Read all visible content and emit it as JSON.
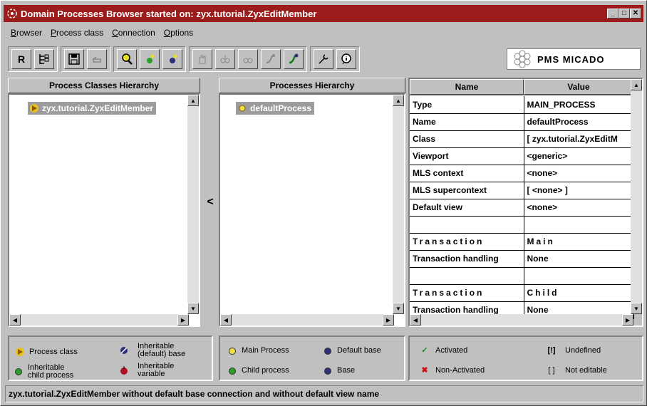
{
  "window": {
    "title": "Domain Processes Browser started on: zyx.tutorial.ZyxEditMember"
  },
  "menu": [
    "Browser",
    "Process class",
    "Connection",
    "Options"
  ],
  "toolbar": {
    "r_label": "R",
    "brand": "PMS MICADO"
  },
  "left_panel": {
    "header": "Process Classes Hierarchy",
    "item": "zyx.tutorial.ZyxEditMember"
  },
  "middle_panel": {
    "header": "Processes Hierarchy",
    "item": "defaultProcess"
  },
  "collapse_label": "<",
  "properties": {
    "col_name": "Name",
    "col_value": "Value",
    "rows": [
      {
        "name": "Type",
        "value": "MAIN_PROCESS",
        "spaced": false
      },
      {
        "name": "Name",
        "value": "defaultProcess",
        "spaced": false
      },
      {
        "name": "Class",
        "value": "[ zyx.tutorial.ZyxEditM",
        "spaced": false
      },
      {
        "name": "Viewport",
        "value": "<generic>",
        "spaced": false
      },
      {
        "name": "MLS context",
        "value": "<none>",
        "spaced": false
      },
      {
        "name": "MLS supercontext",
        "value": "[ <none> ]",
        "spaced": false
      },
      {
        "name": "Default view",
        "value": "<none>",
        "spaced": false
      },
      {
        "name": "",
        "value": "",
        "spaced": false
      },
      {
        "name": "Transaction",
        "value": "Main",
        "spaced": true
      },
      {
        "name": "Transaction handling",
        "value": "None",
        "spaced": false
      },
      {
        "name": "",
        "value": "",
        "spaced": false
      },
      {
        "name": "Transaction",
        "value": "Child",
        "spaced": true
      },
      {
        "name": "Transaction handling",
        "value": "None",
        "spaced": false
      }
    ]
  },
  "legend_left": {
    "process_class": "Process class",
    "inheritable_default_base_1": "Inheritable",
    "inheritable_default_base_2": "(default) base",
    "inheritable_child_1": "Inheritable",
    "inheritable_child_2": "child process",
    "inheritable_var_1": "Inheritable",
    "inheritable_var_2": "variable"
  },
  "legend_middle": {
    "main_process": "Main Process",
    "default_base": "Default base",
    "child_process": "Child process",
    "base": "Base"
  },
  "legend_right": {
    "activated": "Activated",
    "undefined_icon": "[!]",
    "undefined": "Undefined",
    "non_activated": "Non-Activated",
    "not_editable_icon": "[ ]",
    "not_editable": "Not editable"
  },
  "status": "zyx.tutorial.ZyxEditMember without default base connection and without default view name",
  "colors": {
    "title_bar": "#9c1c1c",
    "selection": "#9c9c9c"
  }
}
